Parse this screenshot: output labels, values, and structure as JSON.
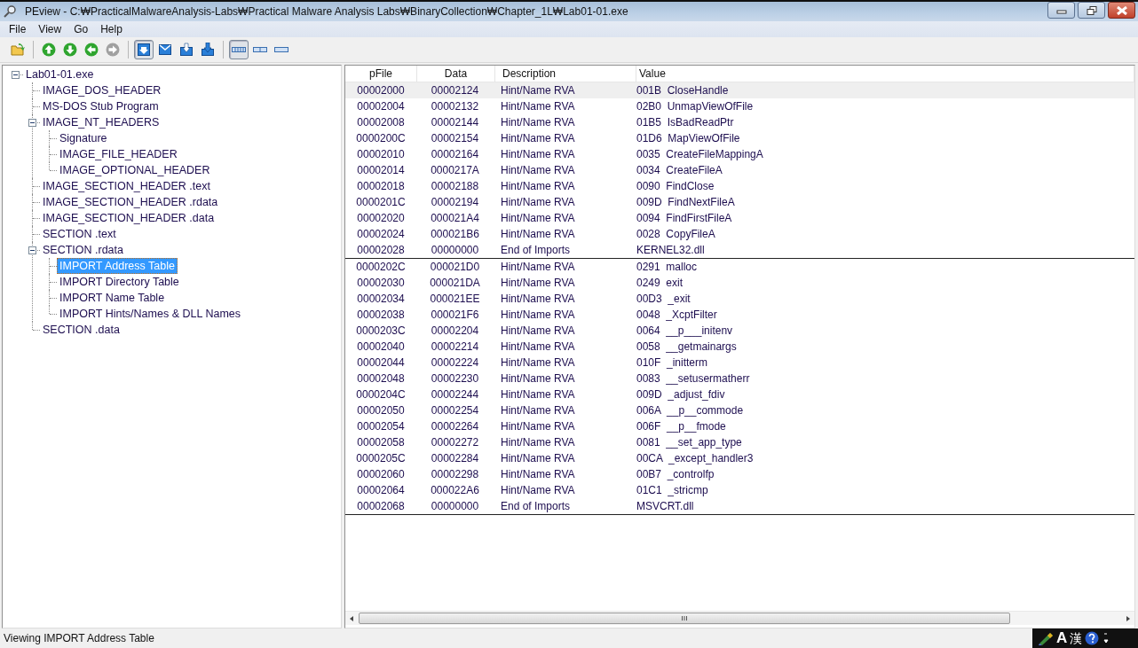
{
  "window": {
    "title": "PEview - C:₩PracticalMalwareAnalysis-Labs₩Practical Malware Analysis Labs₩BinaryCollection₩Chapter_1L₩Lab01-01.exe"
  },
  "menu": [
    "File",
    "View",
    "Go",
    "Help"
  ],
  "toolbar": {
    "navigation": [
      {
        "disabled": false
      },
      {
        "disabled": false
      },
      {
        "disabled": false
      },
      {
        "disabled": true
      }
    ],
    "views": [
      {
        "pressed": true
      },
      {
        "pressed": false
      },
      {
        "pressed": false
      },
      {
        "pressed": false
      }
    ],
    "layouts": [
      {
        "pressed": true
      },
      {
        "pressed": false
      },
      {
        "pressed": false
      }
    ]
  },
  "tree": [
    {
      "label": "Lab01-01.exe",
      "expanded": true,
      "selected": false,
      "children": [
        {
          "label": "IMAGE_DOS_HEADER",
          "selected": false
        },
        {
          "label": "MS-DOS Stub Program",
          "selected": false
        },
        {
          "label": "IMAGE_NT_HEADERS",
          "expanded": true,
          "selected": false,
          "children": [
            {
              "label": "Signature",
              "selected": false
            },
            {
              "label": "IMAGE_FILE_HEADER",
              "selected": false
            },
            {
              "label": "IMAGE_OPTIONAL_HEADER",
              "selected": false
            }
          ]
        },
        {
          "label": "IMAGE_SECTION_HEADER .text",
          "selected": false
        },
        {
          "label": "IMAGE_SECTION_HEADER .rdata",
          "selected": false
        },
        {
          "label": "IMAGE_SECTION_HEADER .data",
          "selected": false
        },
        {
          "label": "SECTION .text",
          "selected": false
        },
        {
          "label": "SECTION .rdata",
          "expanded": true,
          "selected": false,
          "children": [
            {
              "label": "IMPORT Address Table",
              "selected": true
            },
            {
              "label": "IMPORT Directory Table",
              "selected": false
            },
            {
              "label": "IMPORT Name Table",
              "selected": false
            },
            {
              "label": "IMPORT Hints/Names & DLL Names",
              "selected": false
            }
          ]
        },
        {
          "label": "SECTION .data",
          "selected": false
        }
      ]
    }
  ],
  "table": {
    "columns": [
      "pFile",
      "Data",
      "Description",
      "Value"
    ],
    "groups": [
      {
        "rows": [
          {
            "pfile": "00002000",
            "data": "00002124",
            "description": "Hint/Name RVA",
            "value": "001B  CloseHandle",
            "selected": true
          },
          {
            "pfile": "00002004",
            "data": "00002132",
            "description": "Hint/Name RVA",
            "value": "02B0  UnmapViewOfFile",
            "selected": false
          },
          {
            "pfile": "00002008",
            "data": "00002144",
            "description": "Hint/Name RVA",
            "value": "01B5  IsBadReadPtr",
            "selected": false
          },
          {
            "pfile": "0000200C",
            "data": "00002154",
            "description": "Hint/Name RVA",
            "value": "01D6  MapViewOfFile",
            "selected": false
          },
          {
            "pfile": "00002010",
            "data": "00002164",
            "description": "Hint/Name RVA",
            "value": "0035  CreateFileMappingA",
            "selected": false
          },
          {
            "pfile": "00002014",
            "data": "0000217A",
            "description": "Hint/Name RVA",
            "value": "0034  CreateFileA",
            "selected": false
          },
          {
            "pfile": "00002018",
            "data": "00002188",
            "description": "Hint/Name RVA",
            "value": "0090  FindClose",
            "selected": false
          },
          {
            "pfile": "0000201C",
            "data": "00002194",
            "description": "Hint/Name RVA",
            "value": "009D  FindNextFileA",
            "selected": false
          },
          {
            "pfile": "00002020",
            "data": "000021A4",
            "description": "Hint/Name RVA",
            "value": "0094  FindFirstFileA",
            "selected": false
          },
          {
            "pfile": "00002024",
            "data": "000021B6",
            "description": "Hint/Name RVA",
            "value": "0028  CopyFileA",
            "selected": false
          },
          {
            "pfile": "00002028",
            "data": "00000000",
            "description": "End of Imports",
            "value": "KERNEL32.dll",
            "selected": false
          }
        ]
      },
      {
        "rows": [
          {
            "pfile": "0000202C",
            "data": "000021D0",
            "description": "Hint/Name RVA",
            "value": "0291  malloc",
            "selected": false
          },
          {
            "pfile": "00002030",
            "data": "000021DA",
            "description": "Hint/Name RVA",
            "value": "0249  exit",
            "selected": false
          },
          {
            "pfile": "00002034",
            "data": "000021EE",
            "description": "Hint/Name RVA",
            "value": "00D3  _exit",
            "selected": false
          },
          {
            "pfile": "00002038",
            "data": "000021F6",
            "description": "Hint/Name RVA",
            "value": "0048  _XcptFilter",
            "selected": false
          },
          {
            "pfile": "0000203C",
            "data": "00002204",
            "description": "Hint/Name RVA",
            "value": "0064  __p___initenv",
            "selected": false
          },
          {
            "pfile": "00002040",
            "data": "00002214",
            "description": "Hint/Name RVA",
            "value": "0058  __getmainargs",
            "selected": false
          },
          {
            "pfile": "00002044",
            "data": "00002224",
            "description": "Hint/Name RVA",
            "value": "010F  _initterm",
            "selected": false
          },
          {
            "pfile": "00002048",
            "data": "00002230",
            "description": "Hint/Name RVA",
            "value": "0083  __setusermatherr",
            "selected": false
          },
          {
            "pfile": "0000204C",
            "data": "00002244",
            "description": "Hint/Name RVA",
            "value": "009D  _adjust_fdiv",
            "selected": false
          },
          {
            "pfile": "00002050",
            "data": "00002254",
            "description": "Hint/Name RVA",
            "value": "006A  __p__commode",
            "selected": false
          },
          {
            "pfile": "00002054",
            "data": "00002264",
            "description": "Hint/Name RVA",
            "value": "006F  __p__fmode",
            "selected": false
          },
          {
            "pfile": "00002058",
            "data": "00002272",
            "description": "Hint/Name RVA",
            "value": "0081  __set_app_type",
            "selected": false
          },
          {
            "pfile": "0000205C",
            "data": "00002284",
            "description": "Hint/Name RVA",
            "value": "00CA  _except_handler3",
            "selected": false
          },
          {
            "pfile": "00002060",
            "data": "00002298",
            "description": "Hint/Name RVA",
            "value": "00B7  _controlfp",
            "selected": false
          },
          {
            "pfile": "00002064",
            "data": "000022A6",
            "description": "Hint/Name RVA",
            "value": "01C1  _stricmp",
            "selected": false
          },
          {
            "pfile": "00002068",
            "data": "00000000",
            "description": "End of Imports",
            "value": "MSVCRT.dll",
            "selected": false
          }
        ]
      }
    ]
  },
  "status_bar": "Viewing IMPORT Address Table",
  "language_bar": [
    "A",
    "漢"
  ]
}
